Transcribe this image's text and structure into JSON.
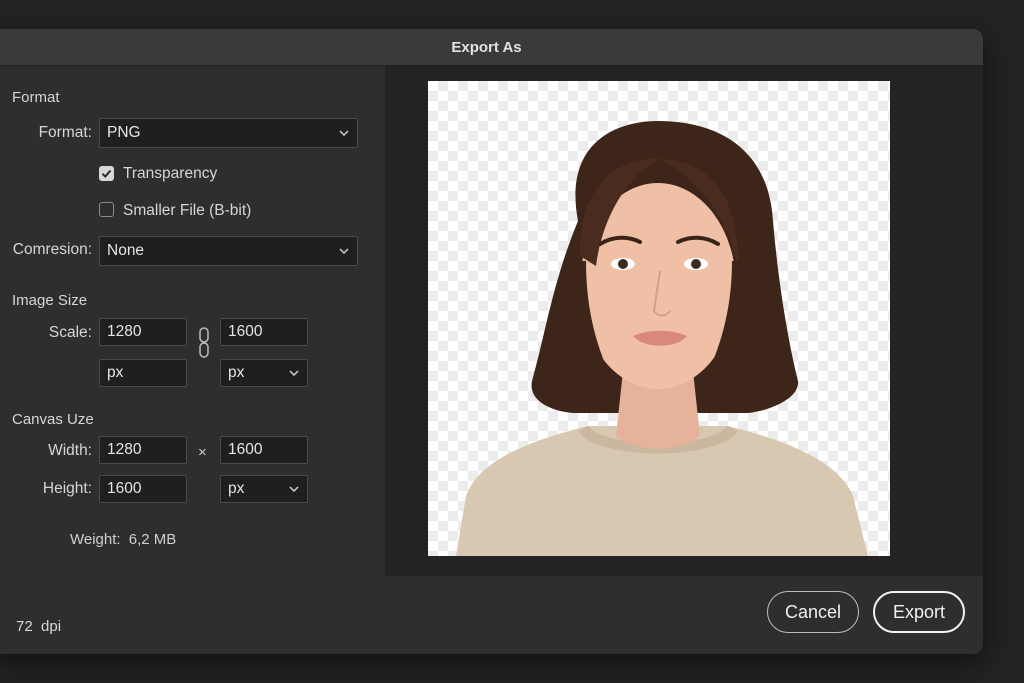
{
  "dialog": {
    "title": "Export As"
  },
  "format_section": {
    "title": "Format",
    "format_label": "Format:",
    "format_value": "PNG",
    "transparency_label": "Transparency",
    "transparency_checked": true,
    "smaller_file_label": "Smaller File (B-bit)",
    "smaller_file_checked": false,
    "compression_label": "Comresion:",
    "compression_value": "None"
  },
  "image_size": {
    "title": "Image Size",
    "scale_label": "Scale:",
    "width_value": "1280",
    "height_value": "1600",
    "unit_left": "px",
    "unit_right": "px"
  },
  "canvas_size": {
    "title": "Canvas Uze",
    "width_label": "Width:",
    "width_value": "1280",
    "times_symbol": "×",
    "width_value_2": "1600",
    "height_label": "Height:",
    "height_value": "1600",
    "unit": "px"
  },
  "weight": {
    "label": "Weight:",
    "value": "6,2 MB"
  },
  "footer": {
    "dpi": "72  dpi"
  },
  "buttons": {
    "cancel": "Cancel",
    "export": "Export"
  },
  "icons": {
    "chevron": "chevron-down-icon",
    "link": "link-chain-icon",
    "check": "checkmark-icon"
  },
  "colors": {
    "background": "#232323",
    "panel": "#2e2e2e",
    "field": "#1f1f1f",
    "sweater": "#d8c8b2",
    "hair": "#3e2519"
  }
}
